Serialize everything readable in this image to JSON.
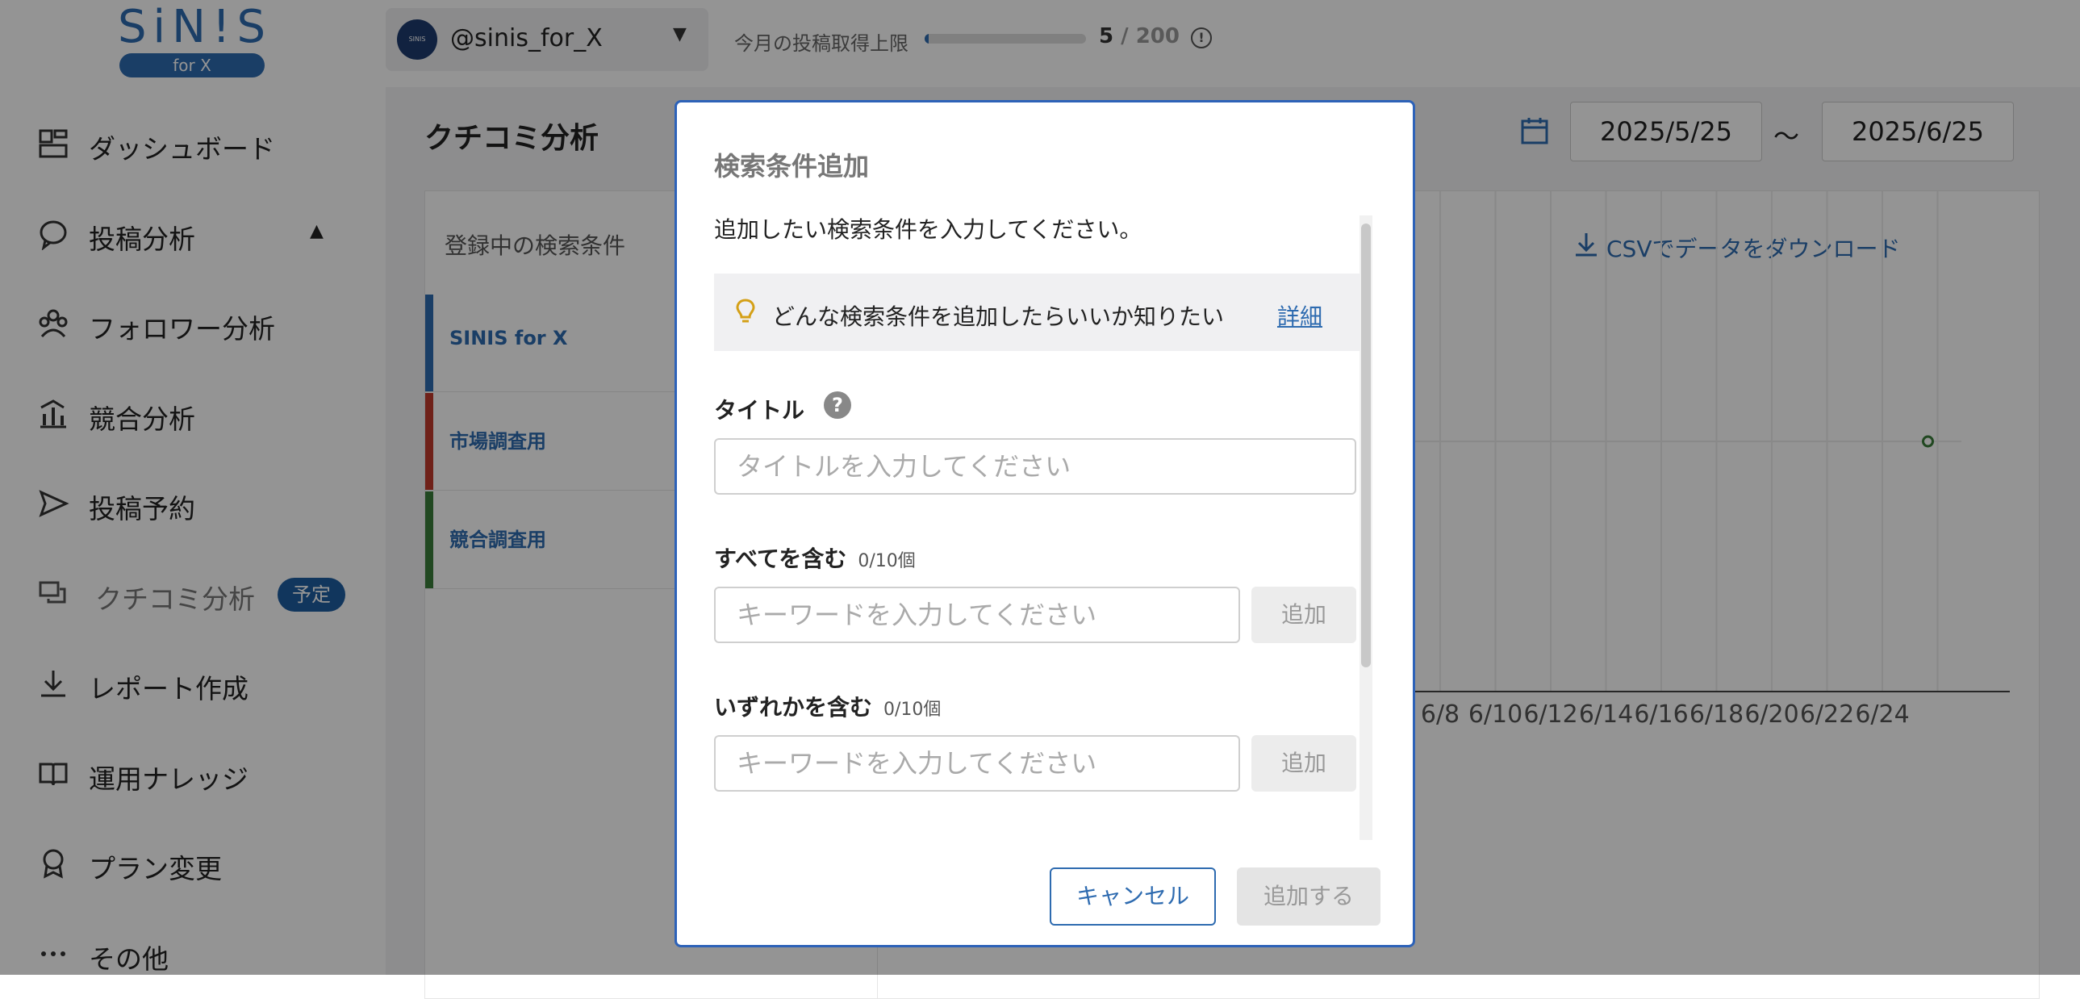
{
  "header": {
    "logo": {
      "main": "SiN!S",
      "sub": "for X"
    },
    "account": {
      "avatar_text": "SINIS",
      "name": "@sinis_for_X"
    },
    "quota": {
      "label": "今月の投稿取得上限",
      "used": "5",
      "separator": " / ",
      "total": "200",
      "fraction": 0.025
    }
  },
  "sidebar": {
    "items": [
      {
        "label": "ダッシュボード",
        "icon": "dashboard-icon"
      },
      {
        "label": "投稿分析",
        "icon": "chat-bubble-icon",
        "expanded": true
      },
      {
        "label": "フォロワー分析",
        "icon": "users-icon"
      },
      {
        "label": "競合分析",
        "icon": "bar-chart-icon"
      },
      {
        "label": "投稿予約",
        "icon": "send-icon"
      },
      {
        "label": "クチコミ分析",
        "icon": "comments-icon",
        "badge": "予定"
      },
      {
        "label": "レポート作成",
        "icon": "download-icon"
      },
      {
        "label": "運用ナレッジ",
        "icon": "book-icon"
      },
      {
        "label": "プラン変更",
        "icon": "badge-icon"
      },
      {
        "label": "その他",
        "icon": "more-icon"
      }
    ]
  },
  "main": {
    "title": "クチコミ分析",
    "date_from": "2025/5/25",
    "date_sep": "〜",
    "date_to": "2025/6/25",
    "conditions_header": "登録中の検索条件",
    "conditions": [
      {
        "label": "SINIS for X",
        "color": "#2e6bb0"
      },
      {
        "label": "市場調査用",
        "color": "#c0392b"
      },
      {
        "label": "競合調査用",
        "color": "#3a7d3a"
      }
    ],
    "csv_link": "CSVでデータをダウンロード"
  },
  "chart_data": {
    "type": "line",
    "x_tick_labels": [
      "6/8",
      "6/10",
      "6/12",
      "6/14",
      "6/16",
      "6/18",
      "6/20",
      "6/22",
      "6/24"
    ],
    "points": [
      {
        "x": "6/25",
        "y": 0
      }
    ]
  },
  "modal": {
    "title": "検索条件追加",
    "intro": "追加したい検索条件を入力してください。",
    "tip_text": "どんな検索条件を追加したらいいか知りたい",
    "tip_link": "詳細",
    "title_label": "タイトル",
    "title_placeholder": "タイトルを入力してください",
    "all_label": "すべてを含む",
    "all_count": "0/10個",
    "all_placeholder": "キーワードを入力してください",
    "all_add": "追加",
    "any_label": "いずれかを含む",
    "any_count": "0/10個",
    "any_placeholder": "キーワードを入力してください",
    "any_add": "追加",
    "cancel": "キャンセル",
    "submit": "追加する"
  },
  "colors": {
    "accent": "#2e6bb0",
    "modal_border": "#2d62b8"
  }
}
